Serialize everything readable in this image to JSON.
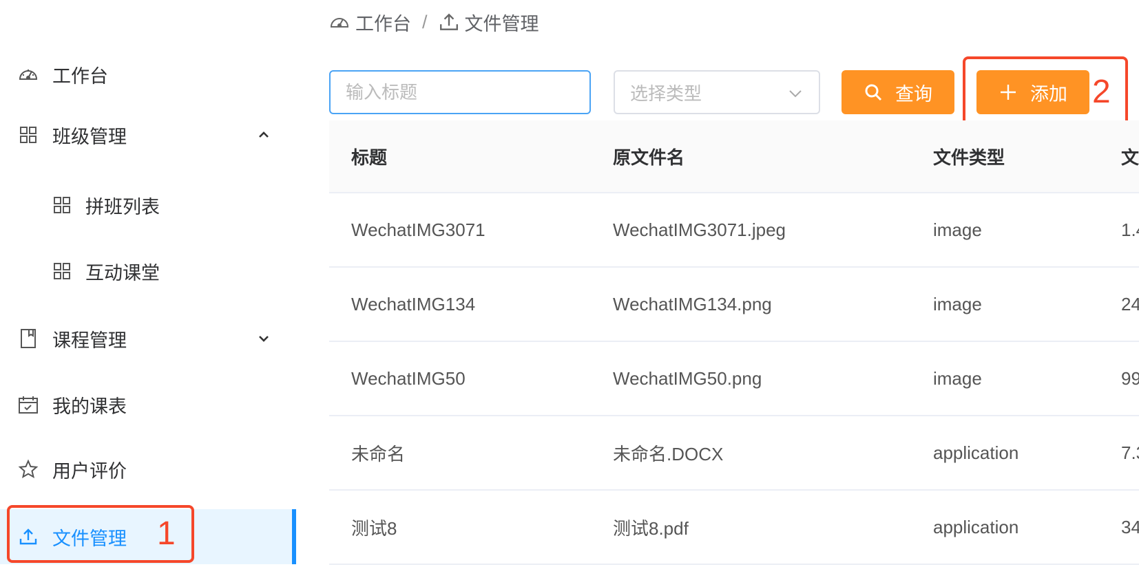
{
  "sidebar": {
    "items": [
      {
        "label": "工作台"
      },
      {
        "label": "班级管理"
      },
      {
        "label": "拼班列表"
      },
      {
        "label": "互动课堂"
      },
      {
        "label": "课程管理"
      },
      {
        "label": "我的课表"
      },
      {
        "label": "用户评价"
      },
      {
        "label": "文件管理"
      }
    ]
  },
  "annotations": {
    "one": "1",
    "two": "2"
  },
  "breadcrumb": {
    "home": "工作台",
    "separator": "/",
    "current": "文件管理"
  },
  "toolbar": {
    "title_placeholder": "输入标题",
    "type_placeholder": "选择类型",
    "query_label": "查询",
    "add_label": "添加"
  },
  "table": {
    "headers": [
      "标题",
      "原文件名",
      "文件类型",
      "文"
    ],
    "rows": [
      [
        "WechatIMG3071",
        "WechatIMG3071.jpeg",
        "image",
        "1.4"
      ],
      [
        "WechatIMG134",
        "WechatIMG134.png",
        "image",
        "24"
      ],
      [
        "WechatIMG50",
        "WechatIMG50.png",
        "image",
        "99"
      ],
      [
        "未命名",
        "未命名.DOCX",
        "application",
        "7.3"
      ],
      [
        "测试8",
        "测试8.pdf",
        "application",
        "34"
      ]
    ]
  },
  "colors": {
    "accent": "#1890ff",
    "button": "#ff9324",
    "annotation": "#f5472a"
  }
}
